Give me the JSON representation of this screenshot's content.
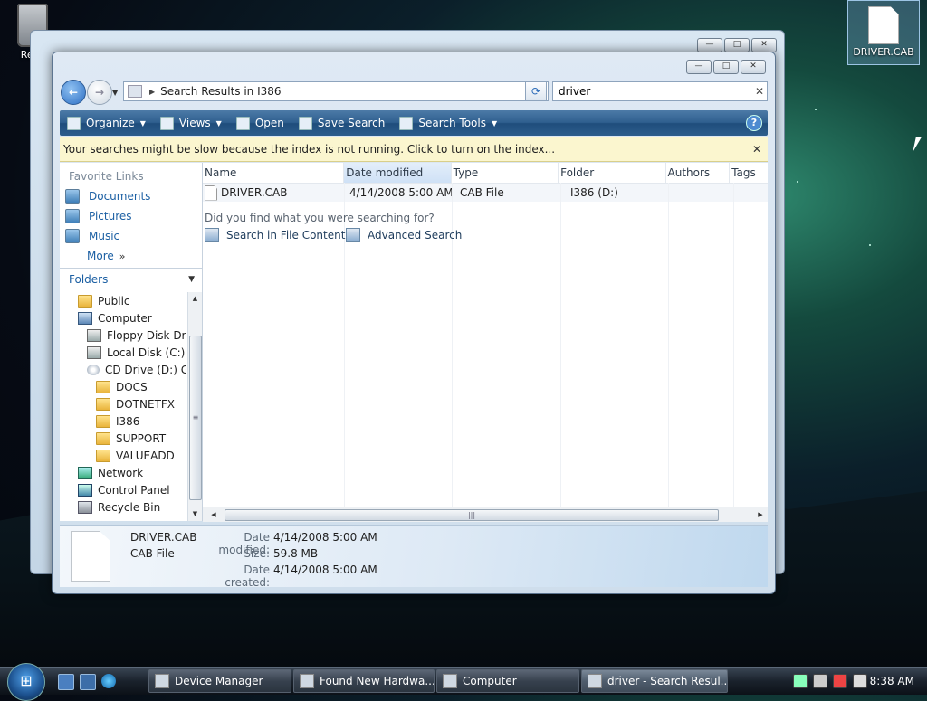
{
  "desktop": {
    "recycle_label": "Recycle Bin",
    "recycle_visible_label": "Recy",
    "driver_icon_label": "DRIVER.CAB"
  },
  "window": {
    "address_crumb": "Search Results in I386",
    "search_value": "driver",
    "toolbar": {
      "organize": "Organize",
      "views": "Views",
      "open": "Open",
      "save_search": "Save Search",
      "search_tools": "Search Tools",
      "help": "?"
    },
    "infobar": "Your searches might be slow because the index is not running.  Click to turn on the index...",
    "favorites": {
      "title": "Favorite Links",
      "items": [
        "Documents",
        "Pictures",
        "Music"
      ],
      "more": "More"
    },
    "folders": {
      "title": "Folders",
      "items": [
        {
          "label": "Public",
          "icon": "folder-icon",
          "indent": 1
        },
        {
          "label": "Computer",
          "icon": "computer-icon",
          "indent": 1
        },
        {
          "label": "Floppy Disk Drive",
          "icon": "floppy-icon",
          "indent": 2
        },
        {
          "label": "Local Disk (C:)",
          "icon": "disk-icon",
          "indent": 2
        },
        {
          "label": "CD Drive (D:) GR",
          "icon": "cd-icon",
          "indent": 2
        },
        {
          "label": "DOCS",
          "icon": "folder-icon",
          "indent": 3
        },
        {
          "label": "DOTNETFX",
          "icon": "folder-icon",
          "indent": 3
        },
        {
          "label": "I386",
          "icon": "folder-icon",
          "indent": 3
        },
        {
          "label": "SUPPORT",
          "icon": "folder-icon",
          "indent": 3
        },
        {
          "label": "VALUEADD",
          "icon": "folder-icon",
          "indent": 3
        },
        {
          "label": "Network",
          "icon": "network-icon",
          "indent": 1
        },
        {
          "label": "Control Panel",
          "icon": "control-panel-icon",
          "indent": 1
        },
        {
          "label": "Recycle Bin",
          "icon": "recycle-bin-icon",
          "indent": 1
        }
      ]
    },
    "columns": [
      "Name",
      "Date modified",
      "Type",
      "Folder",
      "Authors",
      "Tags"
    ],
    "files": [
      {
        "name": "DRIVER.CAB",
        "date": "4/14/2008 5:00 AM",
        "type": "CAB File",
        "folder": "I386 (D:)"
      }
    ],
    "did_you_find": "Did you find what you were searching for?",
    "search_in_contents": "Search in File Contents",
    "advanced_search": "Advanced Search",
    "details": {
      "name": "DRIVER.CAB",
      "type": "CAB File",
      "date_modified_label": "Date modified:",
      "date_modified": "4/14/2008 5:00 AM",
      "size_label": "Size:",
      "size": "59.8 MB",
      "date_created_label": "Date created:",
      "date_created": "4/14/2008 5:00 AM"
    }
  },
  "taskbar": {
    "tasks": [
      "Device Manager",
      "Found New Hardwa...",
      "Computer",
      "driver - Search Resul..."
    ],
    "clock": "8:38 AM"
  }
}
